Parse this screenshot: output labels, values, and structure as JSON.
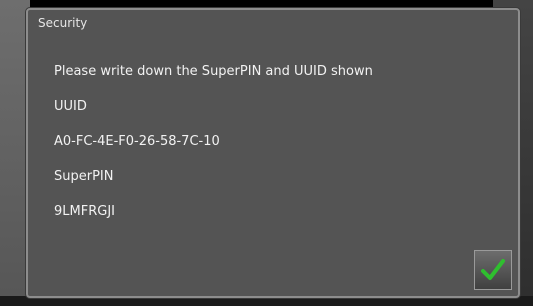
{
  "dialog": {
    "title": "Security",
    "message": "Please write down the SuperPIN and UUID shown",
    "uuid_label": "UUID",
    "uuid_value": "A0-FC-4E-F0-26-58-7C-10",
    "superpin_label": "SuperPIN",
    "superpin_value": "9LMFRGJI"
  },
  "confirm_button": {
    "icon": "checkmark-icon",
    "icon_color": "#2fbf2f"
  }
}
